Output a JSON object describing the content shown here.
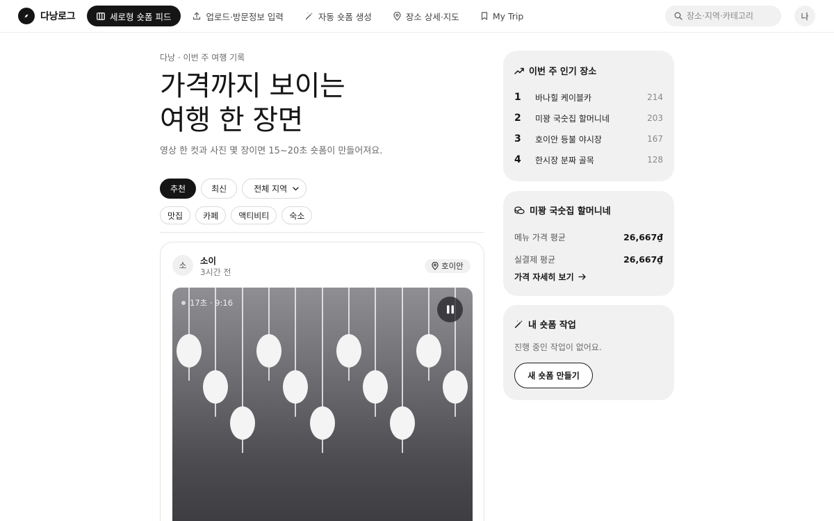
{
  "brand": {
    "name": "다낭로그",
    "logo_icon": "compass-icon"
  },
  "nav": {
    "items": [
      {
        "label": "세로형 숏폼 피드",
        "icon": "feed-icon",
        "active": true
      },
      {
        "label": "업로드·방문정보 입력",
        "icon": "upload-icon",
        "active": false
      },
      {
        "label": "자동 숏폼 생성",
        "icon": "magic-wand-icon",
        "active": false
      },
      {
        "label": "장소 상세·지도",
        "icon": "map-pin-icon",
        "active": false
      },
      {
        "label": "My Trip",
        "icon": "bookmark-icon",
        "active": false
      }
    ]
  },
  "search": {
    "placeholder": "장소·지역·카테고리",
    "icon": "search-icon"
  },
  "user": {
    "avatar": "나"
  },
  "hero": {
    "eyebrow": "다낭 · 이번 주 여행 기록",
    "title_line1": "가격까지 보이는",
    "title_line2": "여행 한 장면",
    "subtitle": "영상 한 컷과 사진 몇 장이면 15~20초 숏폼이 만들어져요."
  },
  "filters": {
    "sort": [
      {
        "label": "추천",
        "active": true
      },
      {
        "label": "최신",
        "active": false
      }
    ],
    "region_select": "전체 지역",
    "categories": [
      "맛집",
      "카페",
      "액티비티",
      "숙소"
    ]
  },
  "post": {
    "author_initial": "소",
    "author": "소이",
    "time": "3시간 전",
    "location": "호이안",
    "video_meta": "17초 · 9:16",
    "playing": true
  },
  "popular": {
    "title": "이번 주 인기 장소",
    "icon": "trending-up-icon",
    "items": [
      {
        "rank": "1",
        "name": "바나힐 케이블카",
        "count": "214"
      },
      {
        "rank": "2",
        "name": "미꽝 국숫집 할머니네",
        "count": "203"
      },
      {
        "rank": "3",
        "name": "호이안 등불 야시장",
        "count": "167"
      },
      {
        "rank": "4",
        "name": "한시장 분짜 골목",
        "count": "128"
      }
    ]
  },
  "price_card": {
    "title": "미꽝 국숫집 할머니네",
    "icon": "coins-icon",
    "rows": [
      {
        "label": "메뉴 가격 평균",
        "value": "26,667₫"
      },
      {
        "label": "실결제 평균",
        "value": "26,667₫"
      }
    ],
    "link": "가격 자세히 보기"
  },
  "jobs": {
    "title": "내 숏폼 작업",
    "icon": "magic-wand-icon",
    "empty": "진행 중인 작업이 없어요.",
    "button": "새 숏폼 만들기"
  },
  "colors": {
    "primary": "#151515",
    "card_bg": "#f1f1f1",
    "muted": "#6b6b6b",
    "border": "#e4e4e4"
  }
}
